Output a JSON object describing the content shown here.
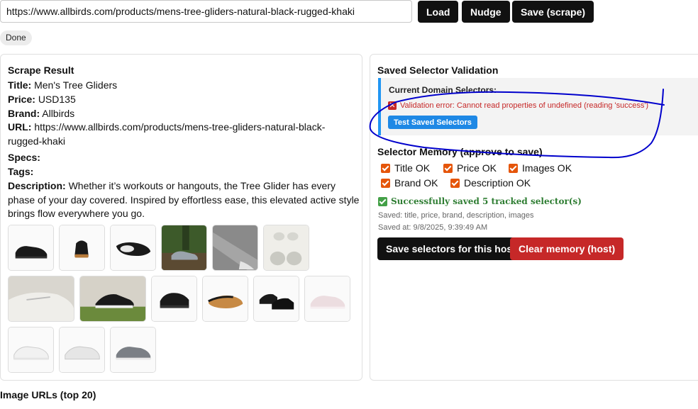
{
  "toolbar": {
    "url_value": "https://www.allbirds.com/products/mens-tree-gliders-natural-black-rugged-khaki",
    "load_label": "Load",
    "nudge_label": "Nudge",
    "save_label": "Save (scrape)"
  },
  "status": "Done",
  "scrape": {
    "heading": "Scrape Result",
    "title_label": "Title:",
    "title_value": "Men's Tree Gliders",
    "price_label": "Price:",
    "price_value": "USD135",
    "brand_label": "Brand:",
    "brand_value": "Allbirds",
    "url_label": "URL:",
    "url_value_line1": "https://www.allbirds.com/products/mens-tree-gliders-natural-black-",
    "url_value_line2": "rugged-khaki",
    "specs_label": "Specs:",
    "tags_label": "Tags:",
    "description_label": "Description:",
    "description_line1": "Whether it’s workouts or hangouts, the Tree Glider has every",
    "description_line2": "phase of your day covered. Inspired by effortless ease, this elevated active style",
    "description_line3": "brings flow everywhere you go.",
    "images": [
      {
        "icon": "black-shoe-side-image"
      },
      {
        "icon": "black-shoe-back-image"
      },
      {
        "icon": "black-shoe-top-image"
      },
      {
        "icon": "grey-shoe-outdoor-image"
      },
      {
        "icon": "grey-knit-closeup-image"
      },
      {
        "icon": "white-soles-image"
      },
      {
        "icon": "white-shoe-closeup-image"
      },
      {
        "icon": "black-shoe-grass-image"
      },
      {
        "icon": "black-shoe-front-image"
      },
      {
        "icon": "gum-sole-image"
      },
      {
        "icon": "black-pair-image"
      },
      {
        "icon": "pink-shoe-image"
      },
      {
        "icon": "white-shoe-side-image"
      },
      {
        "icon": "white-shoe-angle-image"
      },
      {
        "icon": "grey-shoe-side-image"
      }
    ]
  },
  "validation": {
    "heading": "Saved Selector Validation",
    "current_label": "Current Domain Selectors:",
    "error_text": "Validation error: Cannot read properties of undefined (reading 'success')",
    "test_button": "Test Saved Selectors"
  },
  "memory": {
    "heading": "Selector Memory (approve to save)",
    "checks": [
      {
        "label": "Title OK",
        "checked": true
      },
      {
        "label": "Price OK",
        "checked": true
      },
      {
        "label": "Images OK",
        "checked": true
      },
      {
        "label": "Brand OK",
        "checked": true
      },
      {
        "label": "Description OK",
        "checked": true
      }
    ],
    "success_text": "Successfully saved 5 tracked selector(s)",
    "saved_fields": "Saved: title, price, brand, description, images",
    "saved_at": "Saved at: 9/8/2025, 9:39:49 AM",
    "save_button": "Save selectors for this host",
    "clear_button": "Clear memory (host)"
  },
  "image_urls_heading": "Image URLs (top 20)",
  "colors": {
    "accent_blue": "#1e88e5",
    "danger_red": "#c62828",
    "success_green": "#2e7d32",
    "checkbox_orange": "#e5550a",
    "annotation_blue": "#0000cc"
  }
}
